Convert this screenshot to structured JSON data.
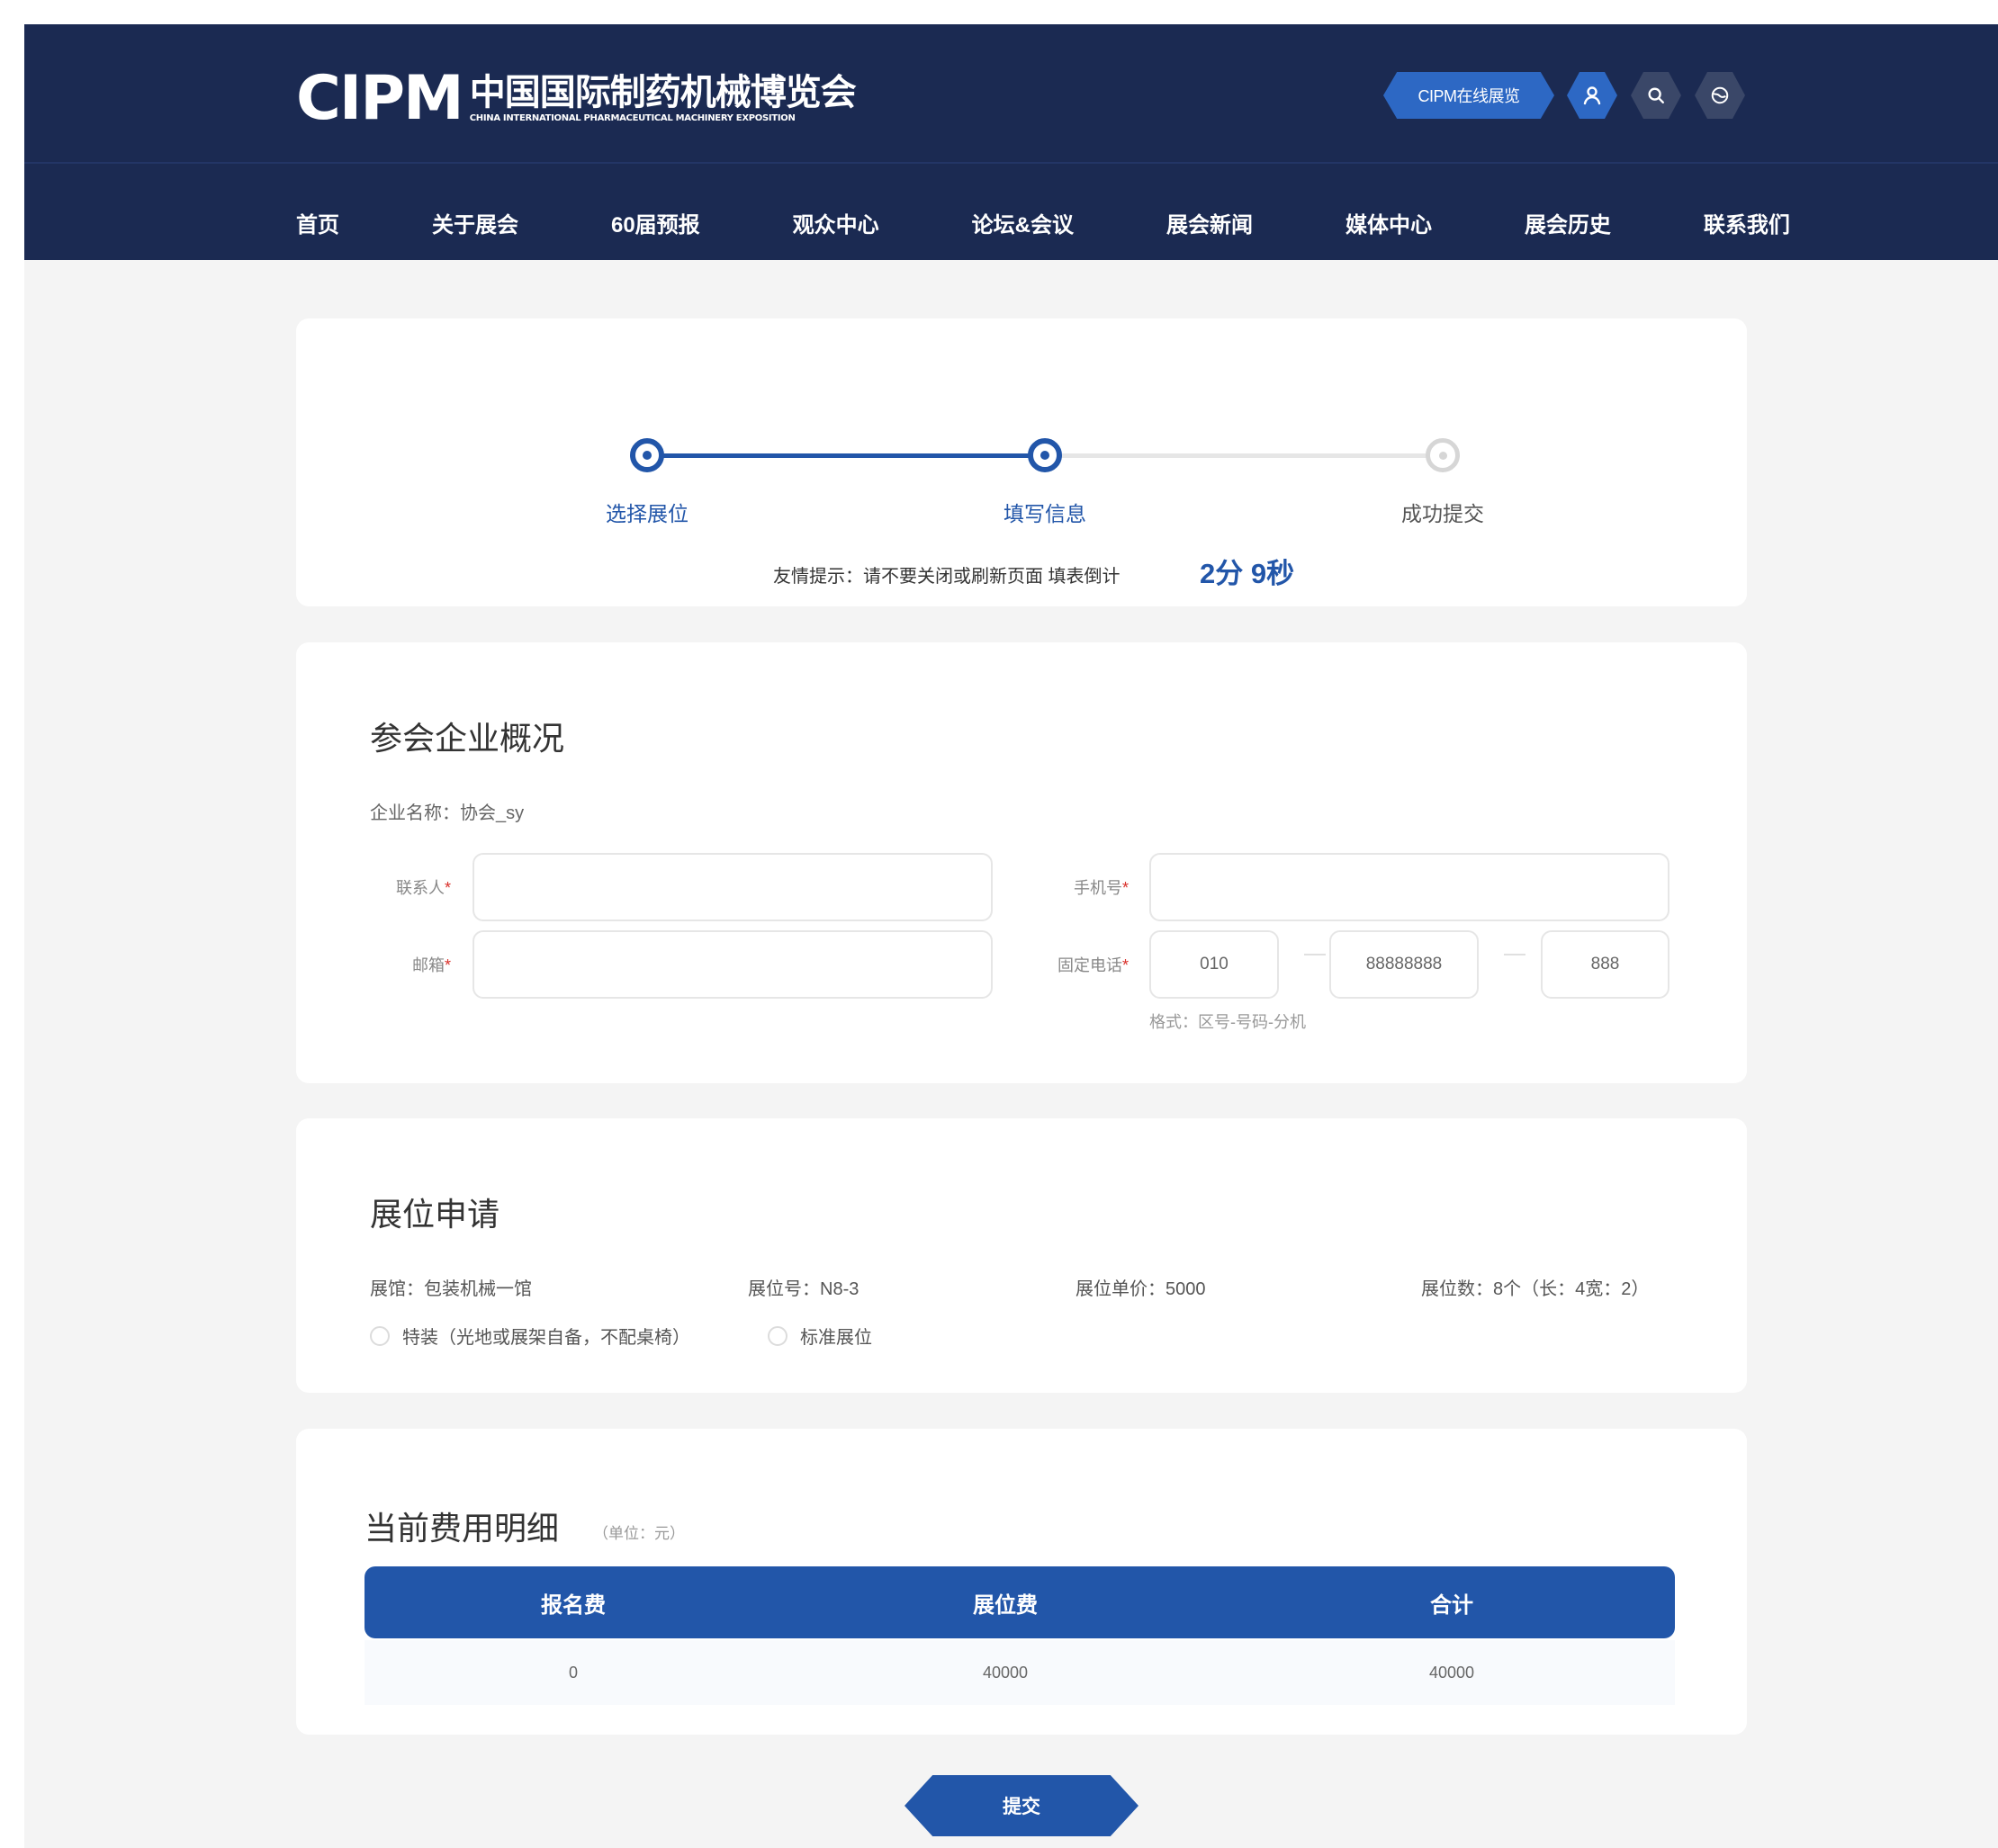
{
  "header": {
    "logo_mark": "CIPM",
    "logo_cn": "中国国际制药机械博览会",
    "logo_en": "CHINA INTERNATIONAL PHARMACEUTICAL MACHINERY EXPOSITION",
    "online_btn": "CIPM在线展览",
    "icons": [
      "user-icon",
      "search-icon",
      "globe-icon"
    ]
  },
  "nav": [
    "首页",
    "关于展会",
    "60届预报",
    "观众中心",
    "论坛&会议",
    "展会新闻",
    "媒体中心",
    "展会历史",
    "联系我们"
  ],
  "steps": {
    "items": [
      {
        "label": "选择展位",
        "state": "active"
      },
      {
        "label": "填写信息",
        "state": "active"
      },
      {
        "label": "成功提交",
        "state": "inactive"
      }
    ],
    "tip": "友情提示：请不要关闭或刷新页面 填表倒计",
    "countdown": "2分 9秒"
  },
  "company_info": {
    "title": "参会企业概况",
    "company_name": "企业名称：协会_sy",
    "contact_label": "联系人",
    "mobile_label": "手机号",
    "email_label": "邮箱",
    "phone_label": "固定电话",
    "required_mark": "*",
    "contact_value": "",
    "mobile_value": "",
    "email_value": "",
    "phone_area": "010",
    "phone_number": "88888888",
    "phone_ext": "888",
    "format_hint": "格式：区号-号码-分机"
  },
  "booth": {
    "title": "展位申请",
    "hall": "展馆：包装机械一馆",
    "number": "展位号：N8-3",
    "price": "展位单价：5000",
    "count": "展位数：8个（长：4宽：2）",
    "option_special": "特装（光地或展架自备，不配桌椅）",
    "option_standard": "标准展位"
  },
  "fees": {
    "title": "当前费用明细",
    "unit": "（单位：元）",
    "headers": [
      "报名费",
      "展位费",
      "合计"
    ],
    "row": [
      "0",
      "40000",
      "40000"
    ]
  },
  "submit_label": "提交",
  "colors": {
    "header_bg": "#1b2a52",
    "accent": "#2256a9",
    "page_bg": "#f4f4f4"
  }
}
